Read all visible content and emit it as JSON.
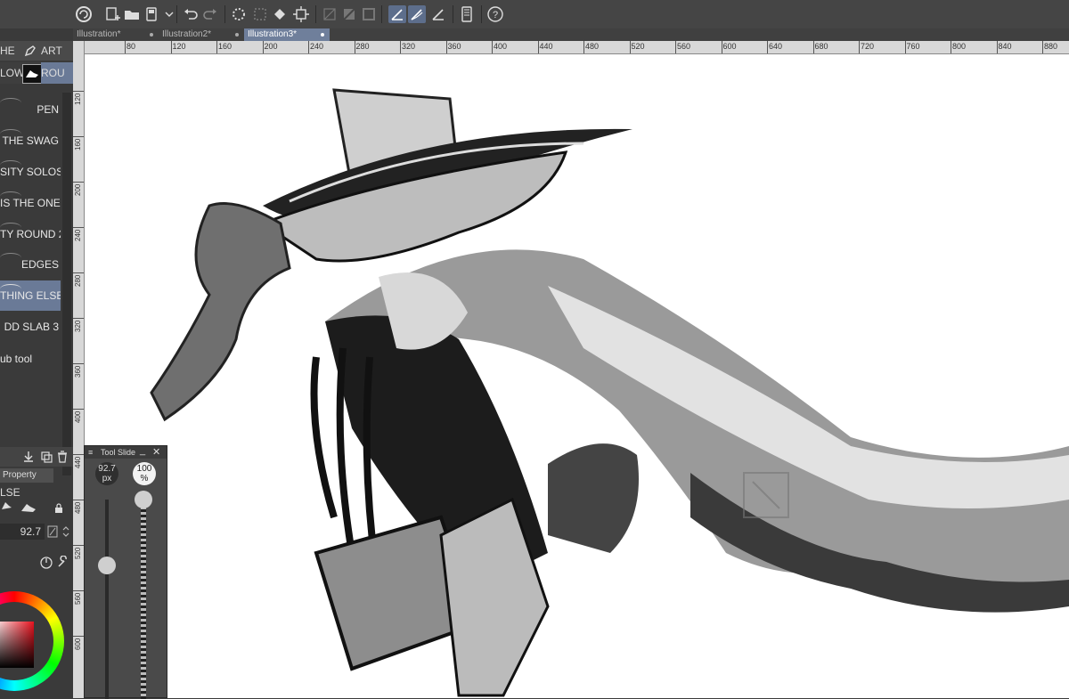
{
  "document_tabs": [
    {
      "label": "Illustration*"
    },
    {
      "label": "Illustration2*"
    },
    {
      "label": "Illustration3*"
    }
  ],
  "ruler_h": [
    "80",
    "120",
    "160",
    "200",
    "240",
    "280",
    "320",
    "360",
    "400",
    "440",
    "480",
    "520",
    "560",
    "600",
    "640",
    "680",
    "720",
    "760",
    "800",
    "840",
    "880"
  ],
  "ruler_v": [
    "120",
    "160",
    "200",
    "240",
    "280",
    "320",
    "360",
    "400",
    "440",
    "480",
    "520",
    "560",
    "600"
  ],
  "sub_tool_tabs": {
    "left": "HE",
    "right": "ART"
  },
  "brush_group_tabs": {
    "left": "LOW",
    "right": "ROU"
  },
  "brushes": [
    {
      "label": "PEN"
    },
    {
      "label": "THE SWAG"
    },
    {
      "label": "SITY  SOLOS"
    },
    {
      "label": "IS THE ONE"
    },
    {
      "label": "TY ROUND 2"
    },
    {
      "label": "EDGES"
    },
    {
      "label": "THING ELSE"
    },
    {
      "label": "DD SLAB 3"
    },
    {
      "label": "ub tool"
    }
  ],
  "property": {
    "tab_label": "Property",
    "brush_name": "LSE",
    "size_value": "92.7"
  },
  "tool_slider": {
    "title": "Tool Slide",
    "size_value": "92.7",
    "size_unit": "px",
    "opacity_value": "100",
    "opacity_unit": "%"
  },
  "colors": {
    "accent_selection": "#6a7a97",
    "canvas": "#ffffff",
    "panel": "#3a3a3a"
  }
}
